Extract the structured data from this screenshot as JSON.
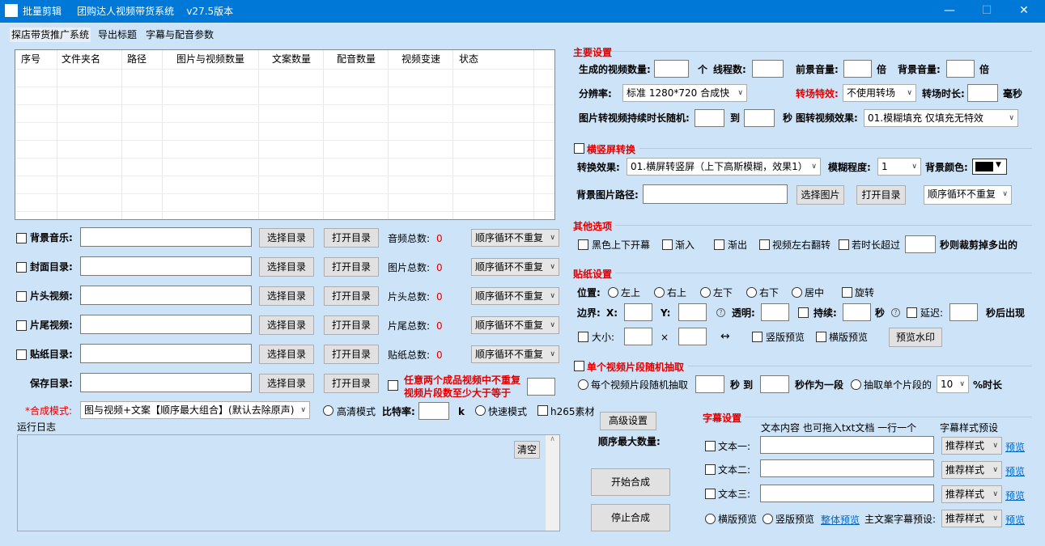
{
  "window": {
    "title": "批量剪辑     团购达人视频带货系统    v27.5版本",
    "min": "—",
    "max": "☐",
    "close": "✕"
  },
  "menu": [
    "探店带货推广系统",
    "导出标题",
    "字幕与配音参数"
  ],
  "grid": {
    "columns": [
      "序号",
      "文件夹名",
      "路径",
      "图片与视频数量",
      "文案数量",
      "配音数量",
      "视频变速",
      "状态"
    ]
  },
  "rows": [
    {
      "label": "背景音乐:",
      "btn1": "选择目录",
      "btn2": "打开目录",
      "count_label": "音频总数:",
      "count": "0",
      "mode": "顺序循环不重复"
    },
    {
      "label": "封面目录:",
      "btn1": "选择目录",
      "btn2": "打开目录",
      "count_label": "图片总数:",
      "count": "0",
      "mode": "顺序循环不重复"
    },
    {
      "label": "片头视频:",
      "btn1": "选择目录",
      "btn2": "打开目录",
      "count_label": "片头总数:",
      "count": "0",
      "mode": "顺序循环不重复"
    },
    {
      "label": "片尾视频:",
      "btn1": "选择目录",
      "btn2": "打开目录",
      "count_label": "片尾总数:",
      "count": "0",
      "mode": "顺序循环不重复"
    },
    {
      "label": "贴纸目录:",
      "btn1": "选择目录",
      "btn2": "打开目录",
      "count_label": "贴纸总数:",
      "count": "0",
      "mode": "顺序循环不重复"
    }
  ],
  "save": {
    "label": "保存目录:",
    "btn1": "选择目录",
    "btn2": "打开目录",
    "hint1": "任意两个成品视频中不重复",
    "hint2": "视频片段数至少大于等于"
  },
  "compose": {
    "label": "*合成模式:",
    "value": "图与视频+文案【顺序最大组合】(默认去除原声)",
    "hd": "高清模式",
    "bitrate": "比特率:",
    "k": "k",
    "fast": "快速模式",
    "h265": "h265素材"
  },
  "log": {
    "title": "运行日志",
    "clear": "清空"
  },
  "main": {
    "title": "主要设置",
    "count_label": "生成的视频数量:",
    "ge": "个",
    "threads": "线程数:",
    "fg_vol": "前景音量:",
    "bei": "倍",
    "bg_vol": "背景音量:",
    "res_label": "分辨率:",
    "res": "标准 1280*720 合成快",
    "trans_label": "转场特效:",
    "trans": "不使用转场",
    "trans_len": "转场时长:",
    "ms": "毫秒",
    "dur_label": "图片转视频持续时长随机:",
    "to": "到",
    "sec": "秒",
    "effect_label": "图转视频效果:",
    "effect": "01.模糊填充 仅填充无特效"
  },
  "orient": {
    "title": "横竖屏转换",
    "effect_label": "转换效果:",
    "effect": "01.横屏转竖屏（上下高斯模糊，效果1）",
    "blur_label": "模糊程度:",
    "blur": "1",
    "color_label": "背景颜色:",
    "color": "#000000",
    "path_label": "背景图片路径:",
    "pick": "选择图片",
    "open": "打开目录",
    "mode": "顺序循环不重复"
  },
  "other": {
    "title": "其他选项",
    "black": "黑色上下开幕",
    "fadein": "渐入",
    "fadeout": "渐出",
    "flip": "视频左右翻转",
    "exceed": "若时长超过",
    "cut": "秒则裁剪掉多出的"
  },
  "sticker": {
    "title": "贴纸设置",
    "pos": "位置:",
    "tl": "左上",
    "tr": "右上",
    "bl": "左下",
    "br": "右下",
    "center": "居中",
    "rotate": "旋转",
    "margin": "边界:",
    "x": "X:",
    "y": "Y:",
    "alpha": "透明:",
    "last": "持续:",
    "sec": "秒",
    "delay": "延迟:",
    "after": "秒后出现",
    "size": "大小:",
    "times": "×",
    "arrow": "↔",
    "vprev": "竖版预览",
    "hprev": "横版预览",
    "watermark": "预览水印"
  },
  "segment": {
    "title": "单个视频片段随机抽取",
    "each": "每个视频片段随机抽取",
    "sec_to": "秒 到",
    "as_one": "秒作为一段",
    "extract": "抽取单个片段的",
    "pct": "10",
    "dur": "%时长"
  },
  "advanced": {
    "btn": "高级设置",
    "max": "顺序最大数量:",
    "start": "开始合成",
    "stop": "停止合成"
  },
  "subtitle": {
    "title": "字幕设置",
    "content_hdr": "文本内容 也可拖入txt文档 一行一个",
    "style_hdr": "字幕样式预设",
    "items": [
      {
        "label": "文本一:",
        "style": "推荐样式",
        "preview": "预览"
      },
      {
        "label": "文本二:",
        "style": "推荐样式",
        "preview": "预览"
      },
      {
        "label": "文本三:",
        "style": "推荐样式",
        "preview": "预览"
      }
    ],
    "h": "横版预览",
    "v": "竖版预览",
    "all": "整体预览",
    "main_label": "主文案字幕预设:",
    "main_style": "推荐样式",
    "main_preview": "预览"
  }
}
